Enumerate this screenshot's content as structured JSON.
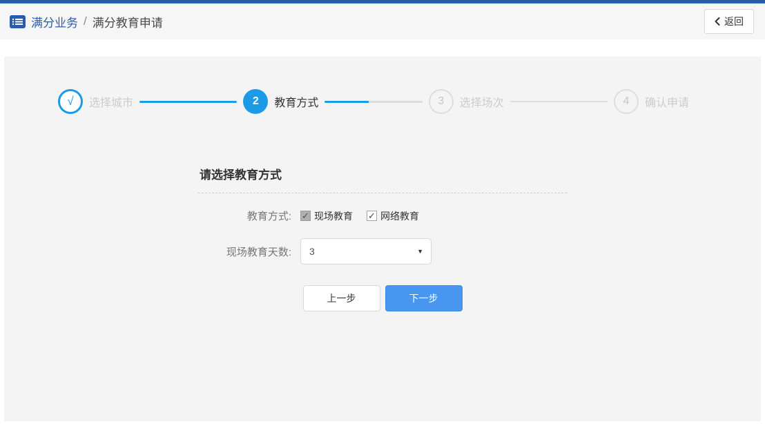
{
  "header": {
    "breadcrumb": {
      "section": "满分业务",
      "separator": "/",
      "page": "满分教育申请"
    },
    "back_button": {
      "label": "返回"
    }
  },
  "wizard": {
    "steps": [
      {
        "indicator": "√",
        "label": "选择城市",
        "state": "done"
      },
      {
        "indicator": "2",
        "label": "教育方式",
        "state": "active"
      },
      {
        "indicator": "3",
        "label": "选择场次",
        "state": "pending"
      },
      {
        "indicator": "4",
        "label": "确认申请",
        "state": "pending"
      }
    ]
  },
  "form": {
    "title": "请选择教育方式",
    "education_method": {
      "label": "教育方式:",
      "options": [
        {
          "label": "现场教育",
          "checked": true,
          "disabled": true
        },
        {
          "label": "网络教育",
          "checked": true,
          "disabled": false
        }
      ]
    },
    "onsite_days": {
      "label": "现场教育天数:",
      "value": "3"
    },
    "buttons": {
      "previous": "上一步",
      "next": "下一步"
    }
  },
  "icons": {
    "check_glyph": "✓",
    "dropdown_arrow": "▼",
    "list_icon": "list-icon",
    "back_chevron_icon": "chevron-left-icon"
  },
  "colors": {
    "brand_blue": "#2A5CAA",
    "step_blue": "#1B9AE8",
    "next_button_blue": "#4896F0",
    "panel_gray": "#f4f4f5",
    "inactive_gray": "#cccccc"
  }
}
